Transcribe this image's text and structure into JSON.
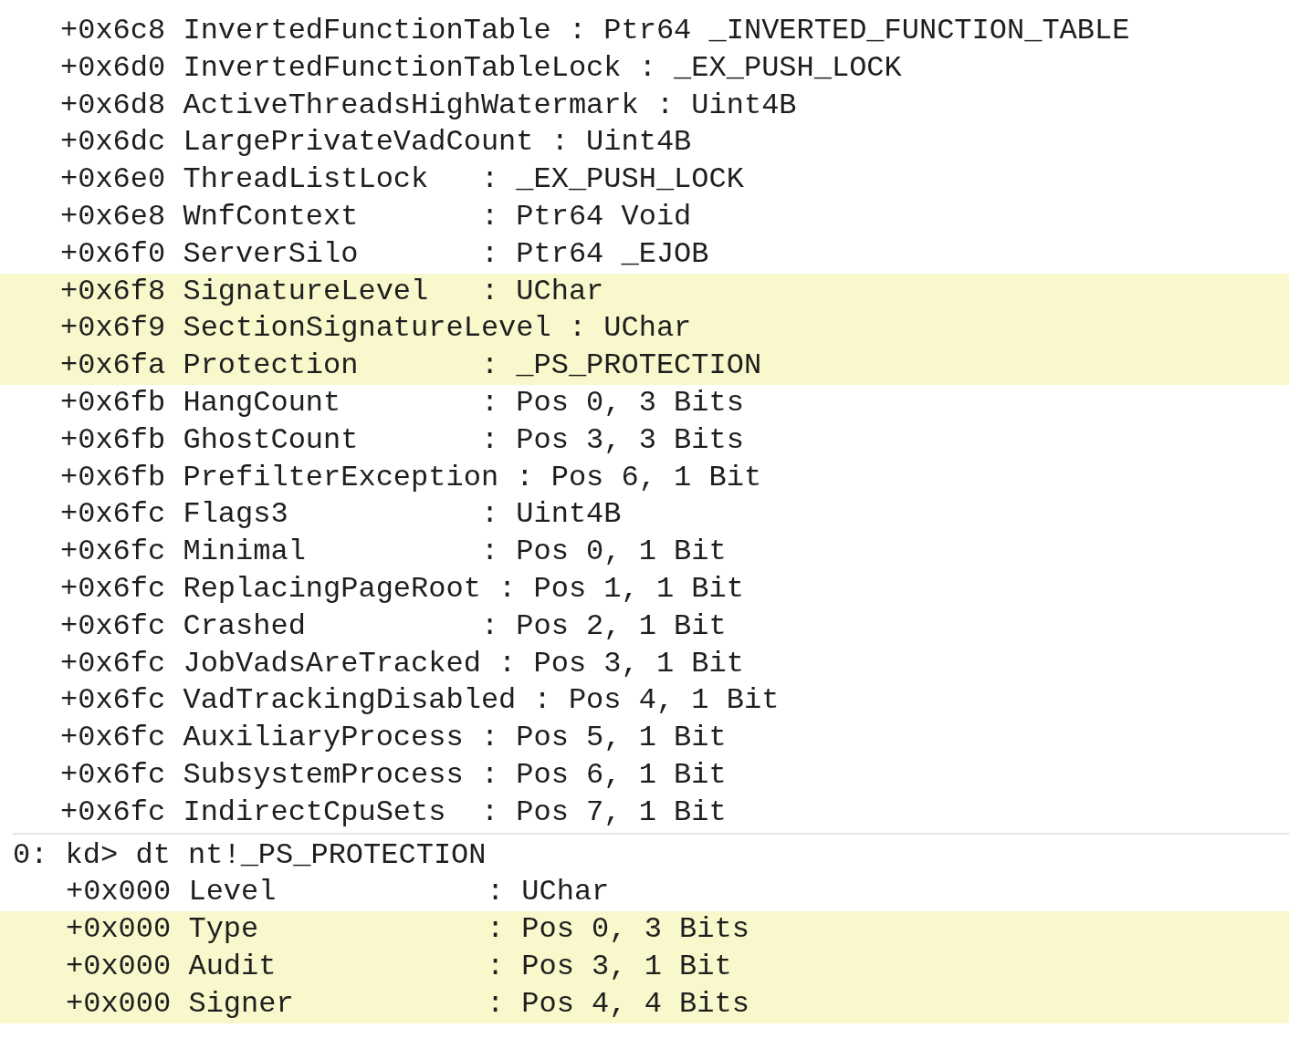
{
  "blocks": [
    {
      "lines": [
        {
          "text": "+0x6c8 InvertedFunctionTable : Ptr64 _INVERTED_FUNCTION_TABLE",
          "highlighted": false
        },
        {
          "text": "+0x6d0 InvertedFunctionTableLock : _EX_PUSH_LOCK",
          "highlighted": false
        },
        {
          "text": "+0x6d8 ActiveThreadsHighWatermark : Uint4B",
          "highlighted": false
        },
        {
          "text": "+0x6dc LargePrivateVadCount : Uint4B",
          "highlighted": false
        },
        {
          "text": "+0x6e0 ThreadListLock   : _EX_PUSH_LOCK",
          "highlighted": false
        },
        {
          "text": "+0x6e8 WnfContext       : Ptr64 Void",
          "highlighted": false
        },
        {
          "text": "+0x6f0 ServerSilo       : Ptr64 _EJOB",
          "highlighted": false
        },
        {
          "text": "+0x6f8 SignatureLevel   : UChar",
          "highlighted": true
        },
        {
          "text": "+0x6f9 SectionSignatureLevel : UChar",
          "highlighted": true
        },
        {
          "text": "+0x6fa Protection       : _PS_PROTECTION",
          "highlighted": true
        },
        {
          "text": "+0x6fb HangCount        : Pos 0, 3 Bits",
          "highlighted": false
        },
        {
          "text": "+0x6fb GhostCount       : Pos 3, 3 Bits",
          "highlighted": false
        },
        {
          "text": "+0x6fb PrefilterException : Pos 6, 1 Bit",
          "highlighted": false
        },
        {
          "text": "+0x6fc Flags3           : Uint4B",
          "highlighted": false
        },
        {
          "text": "+0x6fc Minimal          : Pos 0, 1 Bit",
          "highlighted": false
        },
        {
          "text": "+0x6fc ReplacingPageRoot : Pos 1, 1 Bit",
          "highlighted": false
        },
        {
          "text": "+0x6fc Crashed          : Pos 2, 1 Bit",
          "highlighted": false
        },
        {
          "text": "+0x6fc JobVadsAreTracked : Pos 3, 1 Bit",
          "highlighted": false
        },
        {
          "text": "+0x6fc VadTrackingDisabled : Pos 4, 1 Bit",
          "highlighted": false
        },
        {
          "text": "+0x6fc AuxiliaryProcess : Pos 5, 1 Bit",
          "highlighted": false
        },
        {
          "text": "+0x6fc SubsystemProcess : Pos 6, 1 Bit",
          "highlighted": false
        },
        {
          "text": "+0x6fc IndirectCpuSets  : Pos 7, 1 Bit",
          "highlighted": false
        }
      ]
    },
    {
      "prompt": "0: kd> dt nt!_PS_PROTECTION",
      "lines": [
        {
          "text": "+0x000 Level            : UChar",
          "highlighted": false
        },
        {
          "text": "+0x000 Type             : Pos 0, 3 Bits",
          "highlighted": true
        },
        {
          "text": "+0x000 Audit            : Pos 3, 1 Bit",
          "highlighted": true
        },
        {
          "text": "+0x000 Signer           : Pos 4, 4 Bits",
          "highlighted": true
        }
      ]
    }
  ]
}
